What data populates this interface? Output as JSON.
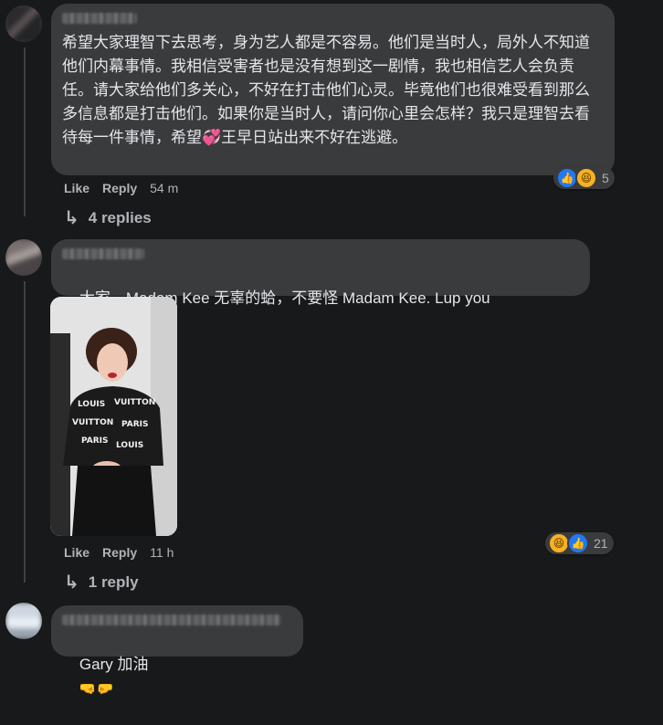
{
  "comments": [
    {
      "text": "希望大家理智下去思考，身为艺人都是不容易。他们是当时人，局外人不知道他们内幕事情。我相信受害者也是没有想到这一剧情，我也相信艺人会负责任。请大家给他们多关心，不好在打击他们心灵。毕竟他们也很难受看到那么多信息都是打击他们。如果你是当时人，请问你心里会怎样？我只是理智去看待每一件事情，希望💞王早日站出来不好在逃避。",
      "like_label": "Like",
      "reply_label": "Reply",
      "time": "54 m",
      "reaction_count": "5",
      "replies_label": "4 replies"
    },
    {
      "text": "大家，Madam Kee 无辜的蛤，不要怪 Madam Kee. Lup you",
      "like_label": "Like",
      "reply_label": "Reply",
      "time": "11 h",
      "reaction_count": "21",
      "replies_label": "1 reply"
    },
    {
      "text": "Gary 加油"
    }
  ],
  "icons": {
    "like": "like-reaction-icon",
    "haha": "haha-reaction-icon",
    "reply_arrow": "reply-arrow-icon",
    "kiss_emoji": "kissing-face-emoji",
    "fist_emoji": "fist-bump-emoji"
  },
  "colors": {
    "background": "#18191a",
    "bubble": "#3a3b3c",
    "text": "#e4e6eb",
    "muted": "#b0b3b8",
    "like_blue": "#2078f4",
    "haha_yellow": "#f7b125"
  }
}
